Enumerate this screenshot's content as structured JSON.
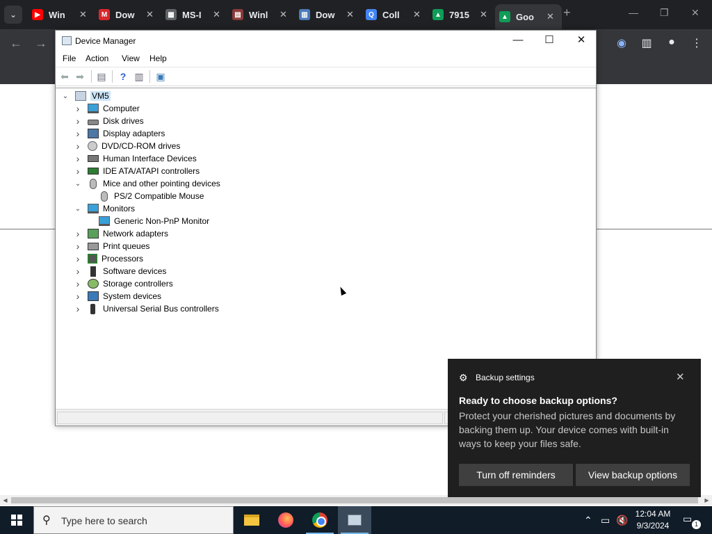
{
  "browser": {
    "tabs": [
      {
        "title": "Win",
        "favicon": "youtube-icon",
        "color": "#ff0000",
        "glyph": "▶"
      },
      {
        "title": "Dow",
        "favicon": "mega-icon",
        "color": "#d9272e",
        "glyph": "M"
      },
      {
        "title": "MS-I",
        "favicon": "ms-icon",
        "color": "#5f6368",
        "glyph": "▦"
      },
      {
        "title": "Winl",
        "favicon": "winrar-icon",
        "color": "#8b3a3a",
        "glyph": "▤"
      },
      {
        "title": "Dow",
        "favicon": "download-site-icon",
        "color": "#4a7ab8",
        "glyph": "▥"
      },
      {
        "title": "Coll",
        "favicon": "search-icon",
        "color": "#4285f4",
        "glyph": "Q"
      },
      {
        "title": "7915",
        "favicon": "google-drive-icon",
        "color": "#0f9d58",
        "glyph": "▲"
      },
      {
        "title": "Goo",
        "favicon": "google-drive-icon",
        "color": "#0f9d58",
        "glyph": "▲",
        "active": true
      }
    ],
    "close_glyph": "✕",
    "new_tab_glyph": "+"
  },
  "window": {
    "title": "Device Manager",
    "menu": [
      "File",
      "Action",
      "View",
      "Help"
    ],
    "minimize_glyph": "—",
    "maximize_glyph": "☐",
    "close_glyph": "✕"
  },
  "tree": {
    "root": "VM5",
    "items": [
      {
        "label": "Computer",
        "icon": "computer-icon",
        "expanded": false
      },
      {
        "label": "Disk drives",
        "icon": "disk-drive-icon",
        "expanded": false
      },
      {
        "label": "Display adapters",
        "icon": "display-adapter-icon",
        "expanded": false
      },
      {
        "label": "DVD/CD-ROM drives",
        "icon": "dvd-drive-icon",
        "expanded": false
      },
      {
        "label": "Human Interface Devices",
        "icon": "hid-icon",
        "expanded": false
      },
      {
        "label": "IDE ATA/ATAPI controllers",
        "icon": "ide-controller-icon",
        "expanded": false
      },
      {
        "label": "Mice and other pointing devices",
        "icon": "mouse-icon",
        "expanded": true,
        "children": [
          "PS/2 Compatible Mouse"
        ]
      },
      {
        "label": "Monitors",
        "icon": "monitor-icon",
        "expanded": true,
        "children": [
          "Generic Non-PnP Monitor"
        ]
      },
      {
        "label": "Network adapters",
        "icon": "network-adapter-icon",
        "expanded": false
      },
      {
        "label": "Print queues",
        "icon": "printer-icon",
        "expanded": false
      },
      {
        "label": "Processors",
        "icon": "processor-icon",
        "expanded": false
      },
      {
        "label": "Software devices",
        "icon": "software-device-icon",
        "expanded": false
      },
      {
        "label": "Storage controllers",
        "icon": "storage-controller-icon",
        "expanded": false
      },
      {
        "label": "System devices",
        "icon": "system-device-icon",
        "expanded": false
      },
      {
        "label": "Universal Serial Bus controllers",
        "icon": "usb-icon",
        "expanded": false
      }
    ]
  },
  "toast": {
    "app": "Backup settings",
    "heading": "Ready to choose backup options?",
    "body": "Protect your cherished pictures and documents by backing them up. Your device comes with built-in ways to keep your files safe.",
    "button_dismiss": "Turn off reminders",
    "button_primary": "View backup options"
  },
  "taskbar": {
    "search_placeholder": "Type here to search",
    "time": "12:04 AM",
    "date": "9/3/2024",
    "notification_count": "1"
  }
}
